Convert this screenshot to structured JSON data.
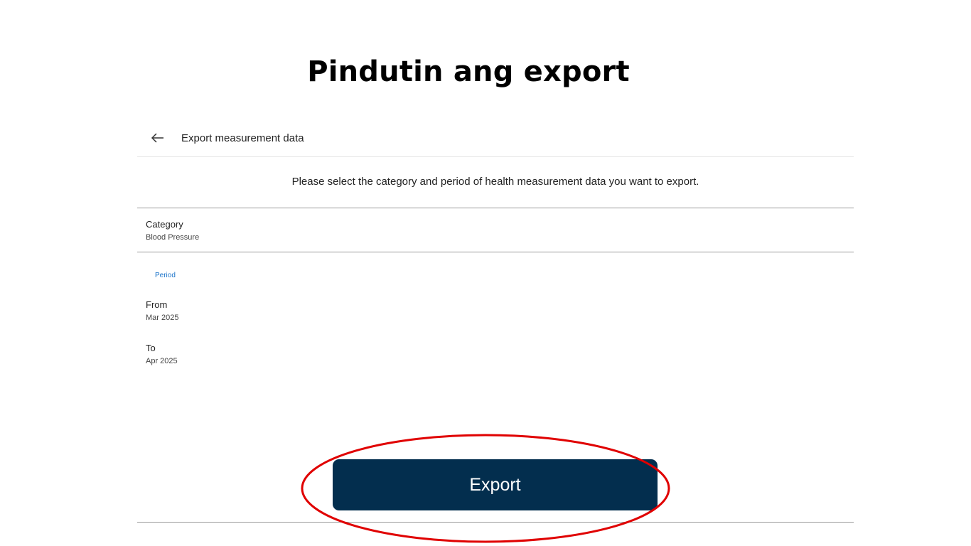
{
  "tutorial": {
    "title": "Pindutin ang export"
  },
  "header": {
    "back_icon": "arrow-left-icon",
    "title": "Export measurement data"
  },
  "instruction": "Please select the category and period of health measurement data you want to export.",
  "category": {
    "label": "Category",
    "value": "Blood Pressure"
  },
  "period": {
    "section_label": "Period",
    "from": {
      "label": "From",
      "value": "Mar 2025"
    },
    "to": {
      "label": "To",
      "value": "Apr 2025"
    }
  },
  "export_button": {
    "label": "Export"
  },
  "colors": {
    "export_button": "#032e4e",
    "period_label": "#1a73c9",
    "annotation": "#e00000"
  }
}
